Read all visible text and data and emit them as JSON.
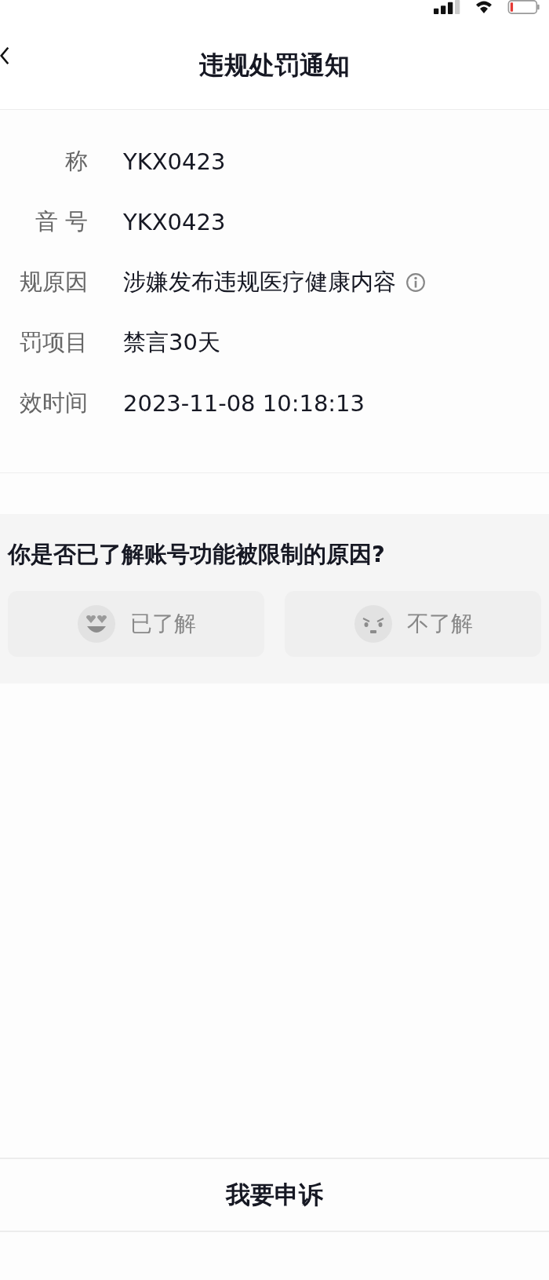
{
  "header": {
    "title": "违规处罚通知"
  },
  "details": [
    {
      "label": "称",
      "value": "YKX0423"
    },
    {
      "label": "音 号",
      "value": "YKX0423"
    },
    {
      "label": "规原因",
      "value": "涉嫌发布违规医疗健康内容",
      "info": true
    },
    {
      "label": "罚项目",
      "value": "禁言30天"
    },
    {
      "label": "效时间",
      "value": "2023-11-08 10:18:13"
    }
  ],
  "survey": {
    "question": "你是否已了解账号功能被限制的原因?",
    "options": [
      {
        "kind": "happy",
        "label": "已了解",
        "selected": false
      },
      {
        "kind": "sad",
        "label": "不了解",
        "selected": false
      }
    ]
  },
  "footer": {
    "button": "我要申诉"
  }
}
